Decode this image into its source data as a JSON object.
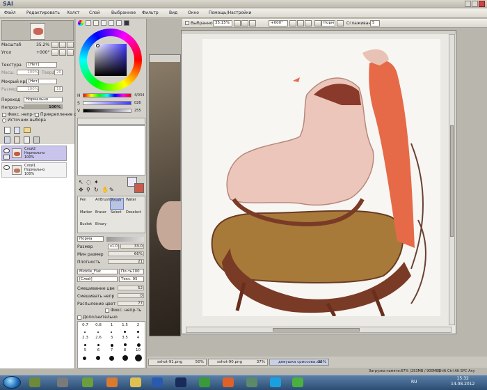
{
  "menu": {
    "items": [
      "Файл",
      "Редактировать",
      "Холст",
      "Слой",
      "Выбранное",
      "Фильтр",
      "Вид",
      "Окно",
      "Помощь/Настройки"
    ]
  },
  "navigator": {
    "zoom_label": "Масштаб",
    "zoom_value": "35.2%",
    "angle_label": "Угол",
    "angle_value": "+000°"
  },
  "layer_props": {
    "texture_label": "Текстура",
    "texture_value": "[Нет]",
    "scale_label": "Масш.",
    "scale_value": "100%",
    "strength_label": "Тверд",
    "strength_value": "20",
    "wet_label": "Мокрый край",
    "wet_value": "[Нет]",
    "size_label": "Размер",
    "size_value": "100%",
    "wet_strength_value": "10",
    "blend_label": "Переход",
    "blend_value": "Нормально",
    "opacity_label": "Непроз-ть",
    "opacity_value": "100%",
    "opacity_fraction": 1.0,
    "preserve_opacity": "Фикс. непр-ть",
    "clip_layer": "Прикрепление слоя",
    "selection_source": "Источник выбора"
  },
  "layers": [
    {
      "name": "Слой2",
      "mode": "Нормально",
      "opacity": "100%",
      "selected": true
    },
    {
      "name": "Слой1",
      "mode": "Нормально",
      "opacity": "100%",
      "selected": false
    }
  ],
  "color": {
    "h_label": "H",
    "h_value": "4/034",
    "s_label": "S",
    "s_value": "026",
    "v_label": "V",
    "v_value": "255",
    "primary": "#ece8fa",
    "secondary": "#cc5a4a"
  },
  "tools": [
    {
      "label": "Pen",
      "selected": false
    },
    {
      "label": "AirBrush",
      "selected": false
    },
    {
      "label": "Brush",
      "selected": true
    },
    {
      "label": "Water",
      "selected": false
    },
    {
      "label": "Marker",
      "selected": false
    },
    {
      "label": "Eraser",
      "selected": false
    },
    {
      "label": "Select",
      "selected": false
    },
    {
      "label": "Deselect",
      "selected": false
    },
    {
      "label": "Bucket",
      "selected": false
    },
    {
      "label": "Binary",
      "selected": false
    }
  ],
  "brush": {
    "mode": "Норма",
    "size_label": "Размер",
    "size_mult": "x1.0",
    "size_value": "33.0",
    "min_size_label": "Мин размер",
    "min_size_value": "66%",
    "density_label": "Плотность",
    "density_value": "21",
    "shape": "Middle_Flat",
    "shape_value": "Пл-ть100",
    "texture": "[Слой]",
    "texture_value": "Текс. 95",
    "blending_label": "Смешивание цве",
    "blending_value": "52",
    "dilution_label": "Смешивать непр",
    "dilution_value": "0",
    "persistence_label": "Распыление цвет",
    "persistence_value": "77",
    "keep_opacity": "Фикс. непр-ть",
    "advanced": "Дополнительно"
  },
  "brush_sizes": [
    "0.7",
    "0.8",
    "1",
    "1.5",
    "2",
    "2.3",
    "2.6",
    "3",
    "3.5",
    "4",
    "5",
    "6",
    "7",
    "8",
    "10"
  ],
  "canvas_toolbar": {
    "selected_label": "Выбранное",
    "zoom": "35.15%",
    "angle": "+000°",
    "mode": "Норм",
    "stabilizer_label": "Сглаживание",
    "stabilizer_value": "5"
  },
  "documents": [
    {
      "name": "sshot-91.png",
      "zoom": "50%",
      "active": false
    },
    {
      "name": "sshot-90.png",
      "zoom": "37%",
      "active": false
    },
    {
      "name": "девушка сриссова.sai",
      "zoom": "35%",
      "active": true
    }
  ],
  "status": {
    "memory": "Загрузка памяти:67% (293MB / 900MB)",
    "keys": "Shift Ctrl Alt SPC Any"
  },
  "taskbar": {
    "lang": "RU",
    "time": "15:32",
    "date": "14.08.2012"
  }
}
